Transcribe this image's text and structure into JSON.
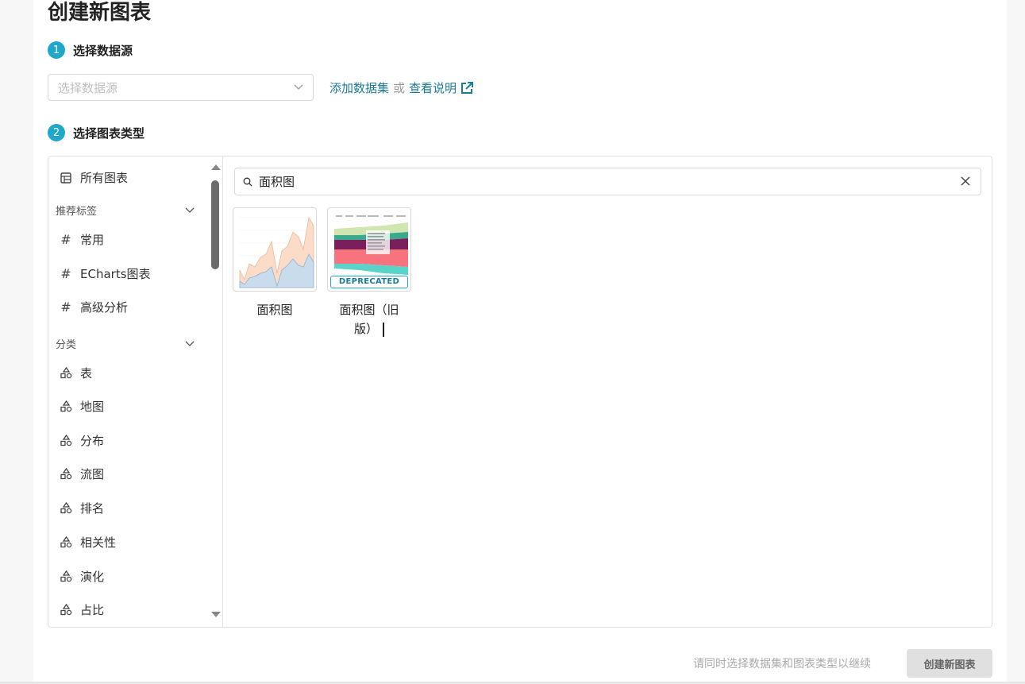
{
  "page": {
    "title": "创建新图表"
  },
  "steps": [
    {
      "num": "1",
      "label": "选择数据源"
    },
    {
      "num": "2",
      "label": "选择图表类型"
    }
  ],
  "datasource": {
    "placeholder": "选择数据源",
    "add_link": "添加数据集",
    "or_text": "或",
    "help_link": "查看说明"
  },
  "sidebar": {
    "all_charts": "所有图表",
    "tags_header": "推荐标签",
    "tags": [
      "常用",
      "ECharts图表",
      "高级分析"
    ],
    "categories_header": "分类",
    "categories": [
      "表",
      "地图",
      "分布",
      "流图",
      "排名",
      "相关性",
      "演化",
      "占比"
    ]
  },
  "search": {
    "value": "面积图"
  },
  "results": [
    {
      "label": "面积图",
      "deprecated": false
    },
    {
      "label_line1": "面积图（旧",
      "label_line2": "版）",
      "badge": "DEPRECATED",
      "deprecated": true
    }
  ],
  "footer": {
    "hint": "请同时选择数据集和图表类型以继续",
    "create_button": "创建新图表"
  },
  "colors": {
    "accent": "#20a7c9",
    "link": "#1b7c99"
  }
}
